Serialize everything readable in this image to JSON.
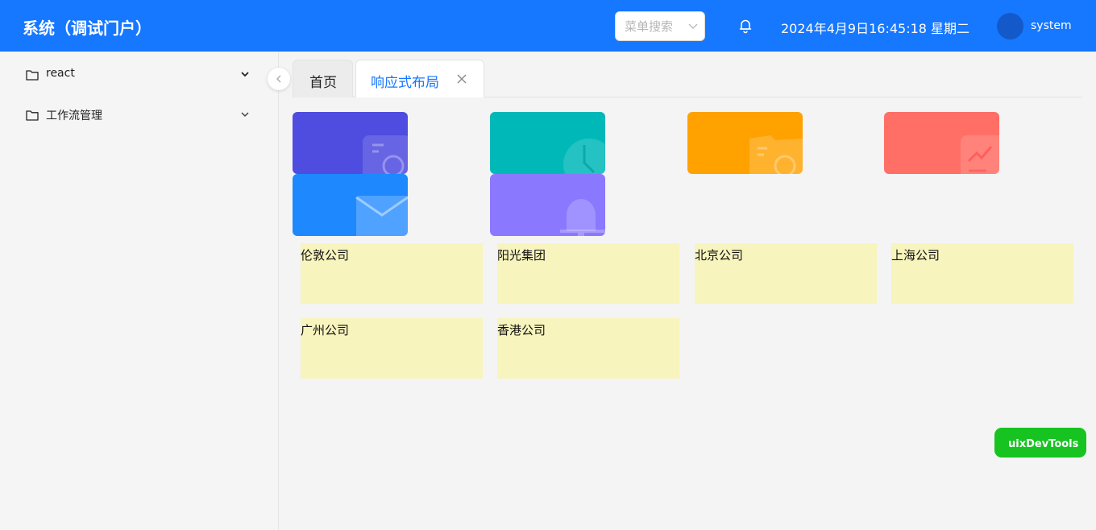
{
  "header": {
    "title": "系统（调试门户）",
    "search_placeholder": "菜单搜索",
    "datetime": "2024年4月9日16:45:18 星期二",
    "username": "system"
  },
  "sidebar": {
    "items": [
      {
        "label": "react",
        "icon": "folder-icon"
      },
      {
        "label": "工作流管理",
        "icon": "folder-icon"
      }
    ]
  },
  "tabs": [
    {
      "label": "首页",
      "active": false
    },
    {
      "label": "响应式布局",
      "active": true,
      "closable": true
    }
  ],
  "stat_cards": [
    {
      "color": "#4f4ce0",
      "icon": "document-clock-icon"
    },
    {
      "color": "#00b8b8",
      "icon": "clock-icon"
    },
    {
      "color": "#ffa200",
      "icon": "book-icon"
    },
    {
      "color": "#ff6f66",
      "icon": "trend-icon"
    },
    {
      "color": "#1e88ff",
      "icon": "mail-icon"
    },
    {
      "color": "#8a78ff",
      "icon": "bell-icon"
    }
  ],
  "companies": [
    "伦敦公司",
    "阳光集团",
    "北京公司",
    "上海公司",
    "广州公司",
    "香港公司"
  ],
  "devtools_label": "uixDevTools"
}
